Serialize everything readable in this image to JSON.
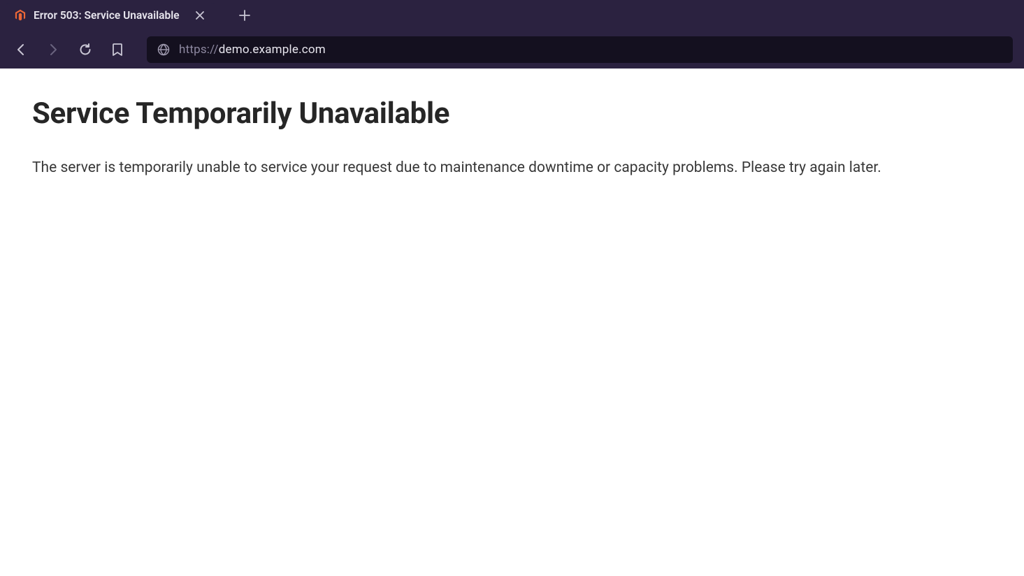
{
  "browser": {
    "tab": {
      "title": "Error 503: Service Unavailable",
      "favicon": "magento-icon"
    },
    "url": {
      "protocol": "https://",
      "domain": "demo.example.com",
      "path": ""
    }
  },
  "page": {
    "heading": "Service Temporarily Unavailable",
    "message": "The server is temporarily unable to service your request due to maintenance downtime or capacity problems. Please try again later."
  }
}
